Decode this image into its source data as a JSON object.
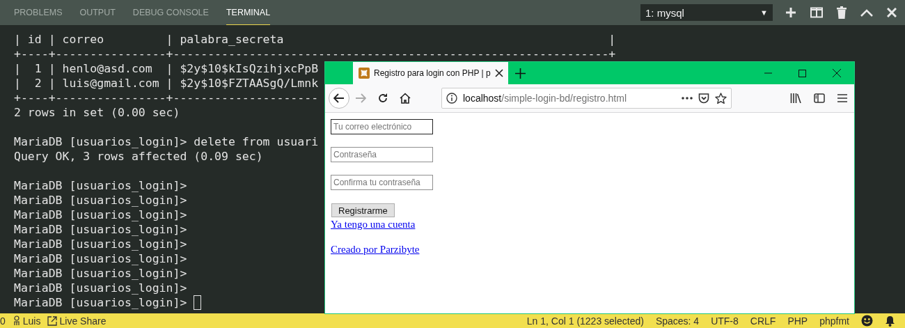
{
  "panel": {
    "tabs": [
      {
        "label": "PROBLEMS",
        "selected": false
      },
      {
        "label": "OUTPUT",
        "selected": false
      },
      {
        "label": "DEBUG CONSOLE",
        "selected": false
      },
      {
        "label": "TERMINAL",
        "selected": true
      }
    ],
    "terminal_select": {
      "value": "1: mysql",
      "arrow": "▼"
    }
  },
  "terminal": {
    "blocks": [
      [
        "| id | correo         | palabra_secreta                                               |",
        "+----+----------------+---------------------------------------------------------------+",
        "|  1 | henlo@asd.com  | $2y$10$kIsQzihjxcPpB",
        "|  2 | luis@gmail.com | $2y$10$FZTAASgQ/Lmnk",
        "+----+----------------+---------------------",
        "2 rows in set (0.00 sec)"
      ],
      [
        "MariaDB [usuarios_login]> delete from usuari",
        "Query OK, 3 rows affected (0.09 sec)"
      ],
      [
        "MariaDB [usuarios_login]>",
        "MariaDB [usuarios_login]>",
        "MariaDB [usuarios_login]>",
        "MariaDB [usuarios_login]>",
        "MariaDB [usuarios_login]>",
        "MariaDB [usuarios_login]>",
        "MariaDB [usuarios_login]>",
        "MariaDB [usuarios_login]>",
        "MariaDB [usuarios_login]>"
      ]
    ]
  },
  "browser": {
    "tab": {
      "title": "Registro para login con PHP | p"
    },
    "address": {
      "host": "localhost",
      "path": "/simple-login-bd/registro.html"
    },
    "form": {
      "fields": [
        {
          "placeholder": "Tu correo electrónico",
          "focused": true
        },
        {
          "placeholder": "Contraseña",
          "focused": false
        },
        {
          "placeholder": "Confirma tu contraseña",
          "focused": false
        }
      ],
      "button": "Registrarme",
      "links": [
        "Ya tengo una cuenta",
        "Creado por Parzibyte"
      ]
    }
  },
  "status_bar": {
    "left": [
      {
        "kind": "count",
        "text": "0"
      },
      {
        "kind": "user",
        "text": "Luis"
      },
      {
        "kind": "share",
        "text": "Live Share"
      }
    ],
    "right": [
      "Ln 1, Col 1 (1223 selected)",
      "Spaces: 4",
      "UTF-8",
      "CRLF",
      "PHP",
      "phpfmt"
    ]
  }
}
